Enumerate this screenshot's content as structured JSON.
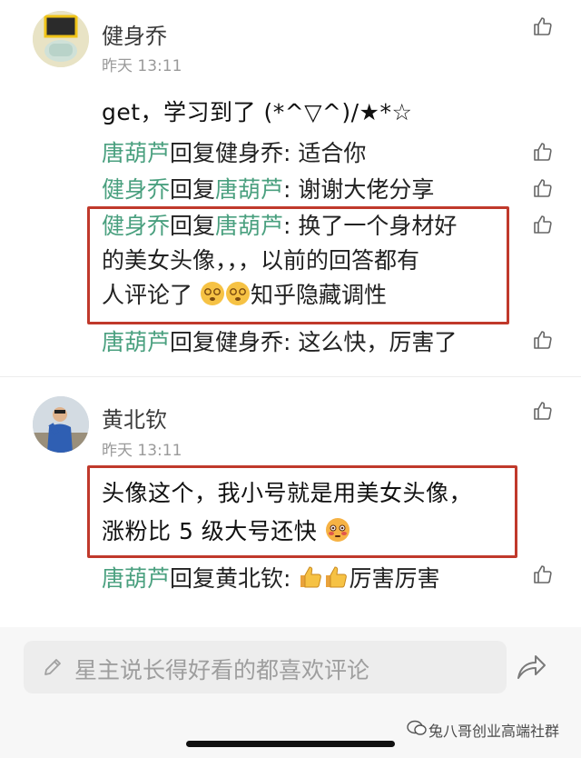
{
  "colors": {
    "reply_name": "#4aa07f",
    "highlight_box": "#c0392b"
  },
  "posts": [
    {
      "username": "健身乔",
      "time": "昨天 13:11",
      "body": "get，学习到了 (*^▽^)/★*☆",
      "replies": [
        {
          "from": "唐葫芦",
          "verb": "回复",
          "to": "健身乔",
          "text": ": 适合你"
        },
        {
          "from": "健身乔",
          "verb": "回复",
          "to": "唐葫芦",
          "text": ": 谢谢大佬分享"
        },
        {
          "from": "健身乔",
          "verb": "回复",
          "to": "唐葫芦",
          "text_line1": ": 换了一个身材好",
          "text_line2": "的美女头像，，，以前的回答都有",
          "text_line3_pre": "人评论了",
          "text_line3_post": "知乎隐藏调性"
        },
        {
          "from": "唐葫芦",
          "verb": "回复",
          "to": "健身乔",
          "text": ": 这么快，厉害了"
        }
      ]
    },
    {
      "username": "黄北钦",
      "time": "昨天 13:11",
      "body_line1": "头像这个，我小号就是用美女头像，",
      "body_line2": "涨粉比 5 级大号还快",
      "replies": [
        {
          "from": "唐葫芦",
          "verb": "回复",
          "to": "黄北钦",
          "text_pre": ":",
          "text_post": "厉害厉害"
        }
      ]
    }
  ],
  "comment_input": {
    "placeholder": "星主说长得好看的都喜欢评论"
  },
  "watermark": {
    "text": "兔八哥创业高端社群"
  }
}
